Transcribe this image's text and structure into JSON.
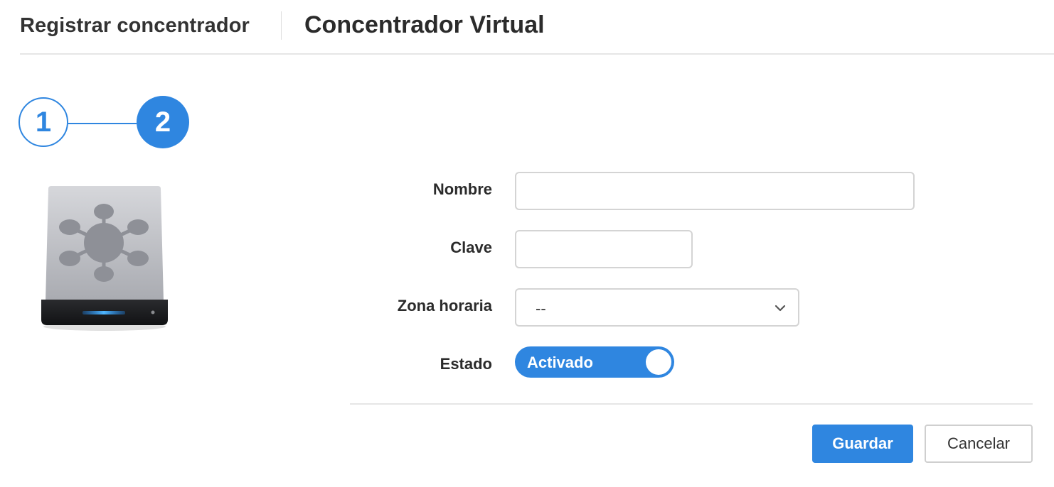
{
  "header": {
    "section_title": "Registrar concentrador",
    "page_title": "Concentrador Virtual"
  },
  "stepper": {
    "steps": [
      "1",
      "2"
    ],
    "current_step": 2
  },
  "form": {
    "name_label": "Nombre",
    "name_value": "",
    "key_label": "Clave",
    "key_value": "",
    "timezone_label": "Zona horaria",
    "timezone_value": "--",
    "status_label": "Estado",
    "status_value": "Activado"
  },
  "actions": {
    "save_label": "Guardar",
    "cancel_label": "Cancelar"
  },
  "colors": {
    "accent": "#2f86e0",
    "border": "#d4d4d4",
    "divider": "#e6e6e6"
  }
}
